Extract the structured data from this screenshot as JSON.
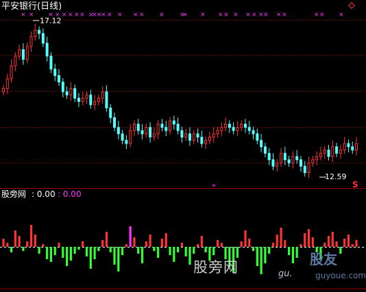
{
  "main_panel": {
    "title": "平安银行(日线)",
    "high_label": "17.12",
    "low_label": "12.59",
    "signal_char": "S",
    "corner_icon": "diamond-icon"
  },
  "sub_panel": {
    "indicator_name": "股旁网",
    "value_1": ": 0.00",
    "value_2": ": 0.00"
  },
  "watermark": {
    "text": "股旁网",
    "url": "gu.",
    "logo_text": "股友",
    "logo_url": "guyoue.com"
  },
  "colors": {
    "background": "#000000",
    "up_candle": "#ff3333",
    "down_candle": "#55ffff",
    "grid": "#990000",
    "cross_markers": "#ff33ff",
    "bar_positive": "#ff3333",
    "bar_negative": "#33ff33",
    "bar_magenta": "#ff33ff",
    "zero_line": "#ffffff"
  },
  "chart_data": [
    {
      "type": "candlestick",
      "series": "daily price",
      "close": [
        15.2,
        15.5,
        15.9,
        16.2,
        16.4,
        16.1,
        16.5,
        16.8,
        17.0,
        16.9,
        16.6,
        16.2,
        15.8,
        15.6,
        15.4,
        15.1,
        15.0,
        15.2,
        14.9,
        14.8,
        14.9,
        15.0,
        14.7,
        14.8,
        14.9,
        15.1,
        14.6,
        14.3,
        14.0,
        13.8,
        13.6,
        13.5,
        13.9,
        14.1,
        13.9,
        13.8,
        14.0,
        13.7,
        13.8,
        14.1,
        14.0,
        13.9,
        14.2,
        14.1,
        13.9,
        13.7,
        13.8,
        13.6,
        13.8,
        13.7,
        13.5,
        13.6,
        13.7,
        13.8,
        13.9,
        14.0,
        14.1,
        14.0,
        13.9,
        14.0,
        14.1,
        14.0,
        13.9,
        13.8,
        13.6,
        13.4,
        13.2,
        13.0,
        12.8,
        12.9,
        13.2,
        13.0,
        12.9,
        13.1,
        13.0,
        12.8,
        12.6,
        12.9,
        13.0,
        13.1,
        13.2,
        13.3,
        13.1,
        13.4,
        13.2,
        13.3,
        13.5,
        13.4,
        13.3,
        13.5
      ],
      "high": 17.12,
      "low": 12.59
    },
    {
      "type": "bar",
      "series": "indicator",
      "values": [
        0.6,
        0.3,
        -0.4,
        1.2,
        0.8,
        -0.3,
        0.4,
        1.6,
        0.9,
        -0.5,
        0.2,
        -0.9,
        -1.1,
        -0.6,
        0.3,
        -0.8,
        -1.4,
        -1.0,
        -0.5,
        -0.2,
        0.4,
        -0.7,
        -1.6,
        -0.9,
        -0.3,
        0.5,
        1.1,
        -0.4,
        -1.3,
        -1.8,
        -0.6,
        0.2,
        1.5,
        0.7,
        -0.5,
        -1.2,
        0.4,
        0.9,
        -0.3,
        -0.8,
        0.6,
        1.0,
        -0.6,
        -1.1,
        -0.4,
        0.3,
        -0.7,
        -1.3,
        -0.5,
        0.2,
        0.8,
        -0.4,
        -1.0,
        -0.6,
        0.5,
        0.3,
        -0.9,
        -1.5,
        -1.9,
        -0.8,
        0.4,
        1.2,
        0.6,
        -0.3,
        -1.4,
        -2.0,
        -1.2,
        -0.5,
        0.3,
        0.9,
        1.4,
        0.5,
        -0.6,
        -1.2,
        -0.8,
        0.2,
        1.0,
        1.3,
        0.7,
        -0.4,
        -0.9,
        0.3,
        0.8,
        1.1,
        0.4,
        -0.5,
        0.6,
        0.9,
        0.2,
        0.5
      ]
    }
  ]
}
